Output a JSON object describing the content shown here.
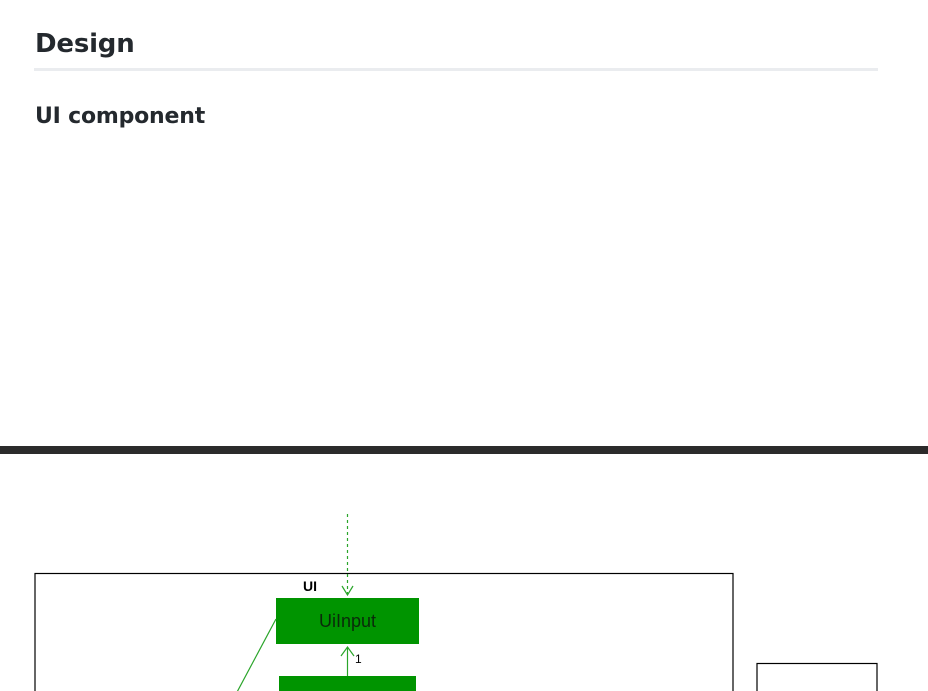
{
  "page": {
    "section_title": "Design",
    "subsection_title": "UI component"
  },
  "diagram": {
    "package_label": "UI",
    "classes": [
      {
        "id": "ui-input",
        "label": "UiInput"
      }
    ],
    "associations": [
      {
        "from": "ui-input",
        "multiplicity": "1"
      }
    ],
    "colors": {
      "class_fill": "#009400",
      "connector": "#2aa52a",
      "frame": "#000000"
    }
  }
}
